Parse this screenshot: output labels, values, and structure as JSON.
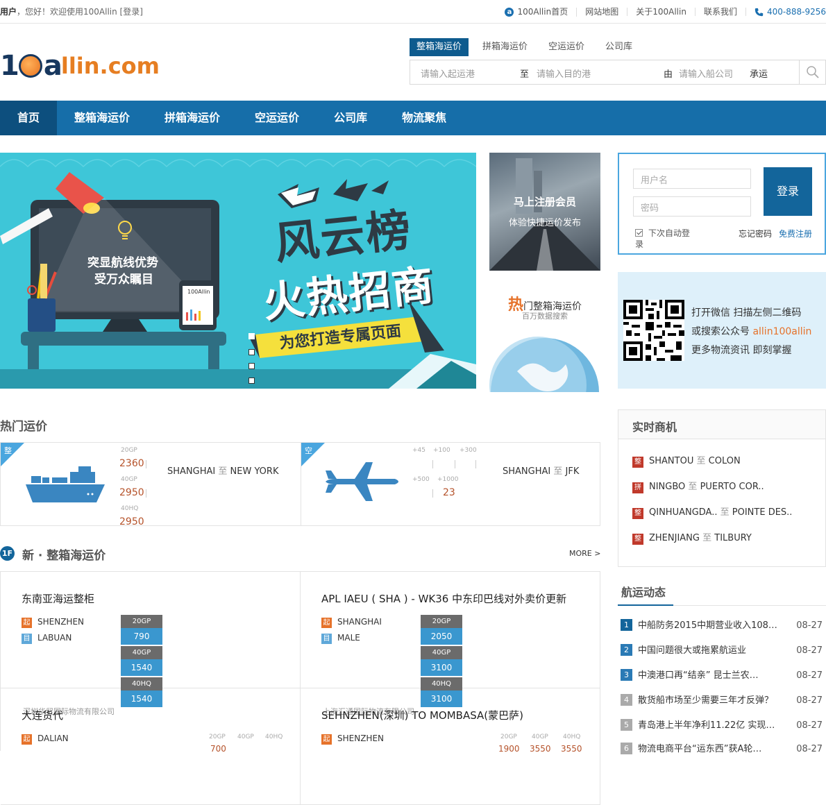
{
  "topbar": {
    "greet_user": "用户",
    "greet_text": "，您好！欢迎使用100Allin [登录]",
    "links": [
      "100Allin首页",
      "网站地图",
      "关于100Allin",
      "联系我们"
    ],
    "phone": "400-888-9256"
  },
  "logo": {
    "brand": "llin.com"
  },
  "search": {
    "tabs": [
      "整箱海运价",
      "拼箱海运价",
      "空运运价",
      "公司库"
    ],
    "from_placeholder": "请输入起运港",
    "to_label": "至",
    "to_placeholder": "请输入目的港",
    "carrier_label": "由",
    "carrier_placeholder": "请输入船公司",
    "carrier_suffix": "承运"
  },
  "nav": [
    "首页",
    "整箱海运价",
    "拼箱海运价",
    "空运运价",
    "公司库",
    "物流聚焦"
  ],
  "banner": {
    "title1": "风云榜",
    "title2": "火热招商",
    "ribbon": "为您打造专属页面",
    "screen_line1": "突显航线优势",
    "screen_line2": "受万众瞩目",
    "tablet_label": "100Allin"
  },
  "promo1": {
    "line1": "马上注册会员",
    "line2": "体验快捷运价发布"
  },
  "promo2": {
    "hot": "热",
    "title": "门整箱海运价",
    "sub": "百万数据搜索"
  },
  "login": {
    "user_placeholder": "用户名",
    "pass_placeholder": "密码",
    "button": "登录",
    "auto_login": "下次自动登录",
    "forget": "忘记密码",
    "register": "免费注册"
  },
  "wechat": {
    "line1": "打开微信  扫描左侧二维码",
    "line2_pre": "或搜索公众号 ",
    "line2_acc": "allin100allin",
    "line3": "更多物流资讯  即刻掌握"
  },
  "hot": {
    "title": "热门运价",
    "sea": {
      "tag": "整",
      "labels": [
        "20GP",
        "40GP",
        "40HQ"
      ],
      "prices": [
        "2360",
        "2950",
        "2950"
      ],
      "origin": "SHANGHAI",
      "to": "至",
      "dest": "NEW YORK"
    },
    "air": {
      "tag": "空",
      "labels_top": [
        "+45",
        "+100",
        "+300"
      ],
      "labels_bottom": [
        "+500",
        "+1000"
      ],
      "price": "23",
      "origin": "SHANGHAI",
      "to": "至",
      "dest": "JFK"
    }
  },
  "realtime": {
    "title": "实时商机",
    "items": [
      {
        "tag": "整",
        "from": "SHANTOU",
        "to": "至",
        "dest": "COLON"
      },
      {
        "tag": "拼",
        "from": "NINGBO",
        "to": "至",
        "dest": "PUERTO COR.."
      },
      {
        "tag": "整",
        "from": "QINHUANGDA..",
        "to": "至",
        "dest": "POINTE DES.."
      },
      {
        "tag": "整",
        "from": "ZHENJIANG",
        "to": "至",
        "dest": "TILBURY"
      }
    ]
  },
  "floor": {
    "badge": "1F",
    "title": "新 · 整箱海运价",
    "more": "MORE >",
    "cards": [
      {
        "title": "东南亚海运整柜",
        "from_tag": "起",
        "from": "SHENZHEN",
        "to_tag": "目",
        "to": "LABUAN",
        "labels": [
          "20GP",
          "40GP",
          "40HQ"
        ],
        "prices": [
          "790",
          "1540",
          "1540"
        ]
      },
      {
        "title": "APL IAEU ( SHA ) - WK36 中东印巴线对外卖价更新",
        "from_tag": "起",
        "from": "SHANGHAI",
        "to_tag": "目",
        "to": "MALE",
        "labels": [
          "20GP",
          "40GP",
          "40HQ"
        ],
        "prices": [
          "2050",
          "3100",
          "3100"
        ]
      },
      {
        "title": "大连货代",
        "watermark": "深圳华贸国际物流有限公司",
        "from_tag": "起",
        "from": "DALIAN",
        "labels": [
          "20GP",
          "40GP",
          "40HQ"
        ],
        "prices": [
          "700"
        ]
      },
      {
        "title": "SEHNZHEN(深圳) TO MOMBASA(蒙巴萨)",
        "watermark": "上海汇通国际物流有限公司",
        "from_tag": "起",
        "from": "SHENZHEN",
        "labels": [
          "20GP",
          "40GP",
          "40HQ"
        ],
        "prices": [
          "1900",
          "3550",
          "3550"
        ]
      }
    ]
  },
  "news": {
    "title": "航运动态",
    "items": [
      {
        "n": "1",
        "text": "中船防务2015中期营业收入108…",
        "date": "08-27"
      },
      {
        "n": "2",
        "text": "中国问题很大或拖累航运业",
        "date": "08-27"
      },
      {
        "n": "3",
        "text": "中澳港口再“结亲” 昆士兰农…",
        "date": "08-27"
      },
      {
        "n": "4",
        "text": "散货船市场至少需要三年才反弹？",
        "date": "08-27"
      },
      {
        "n": "5",
        "text": "青岛港上半年净利11.22亿 实现…",
        "date": "08-27"
      },
      {
        "n": "6",
        "text": "物流电商平台“运东西”获A轮…",
        "date": "08-27"
      }
    ]
  }
}
